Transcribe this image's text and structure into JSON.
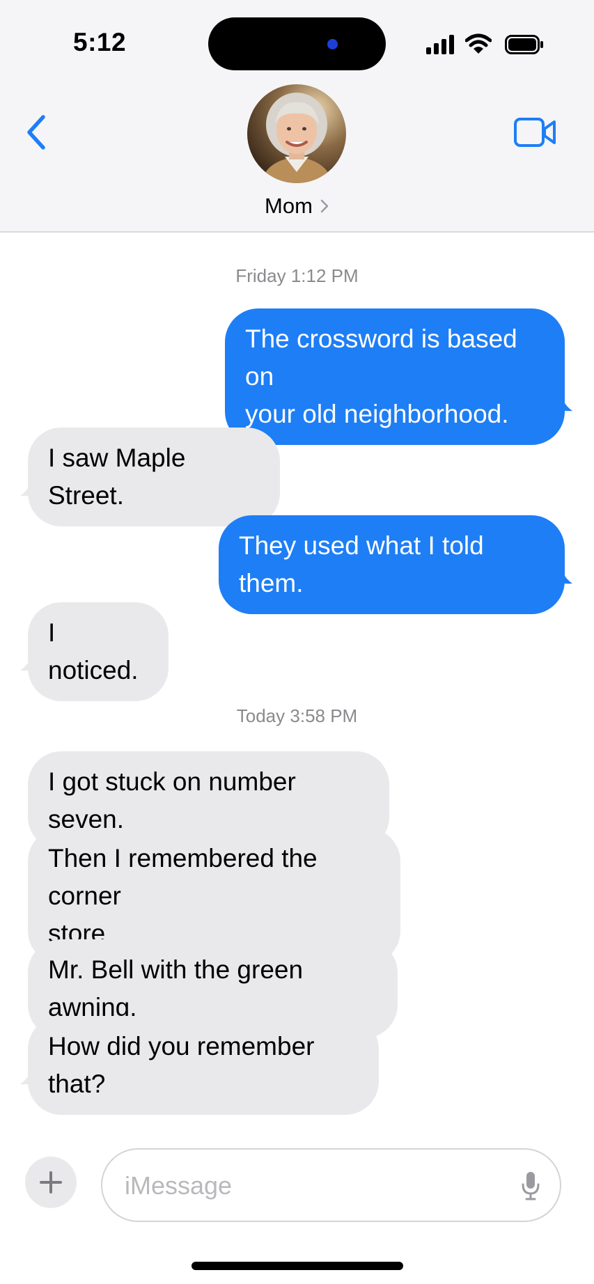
{
  "status_bar": {
    "time": "5:12"
  },
  "header": {
    "contact_name": "Mom"
  },
  "conversation": {
    "timestamps": [
      {
        "label": "Friday",
        "time": "1:12 PM"
      },
      {
        "label": "Today",
        "time": "3:58 PM"
      }
    ],
    "messages": [
      {
        "sender": "me",
        "lines": [
          "The crossword is based on",
          "your old neighborhood."
        ]
      },
      {
        "sender": "mom",
        "lines": [
          "I saw Maple Street."
        ]
      },
      {
        "sender": "me",
        "lines": [
          "They used what I told them."
        ]
      },
      {
        "sender": "mom",
        "lines": [
          "I noticed."
        ]
      },
      {
        "sender": "mom",
        "lines": [
          "I got stuck on number seven."
        ]
      },
      {
        "sender": "mom",
        "lines": [
          "Then I remembered the corner",
          "store."
        ]
      },
      {
        "sender": "mom",
        "lines": [
          "Mr. Bell with the green awning."
        ]
      },
      {
        "sender": "mom",
        "lines": [
          "How did you remember that?"
        ]
      }
    ]
  },
  "input_bar": {
    "placeholder": "iMessage",
    "value": ""
  },
  "icons": {
    "back": "chevron-left-icon",
    "video": "video-camera-icon",
    "plus": "plus-icon",
    "mic": "microphone-icon",
    "signal": "cellular-signal-icon",
    "wifi": "wifi-icon",
    "battery": "battery-icon"
  },
  "colors": {
    "accent": "#1e7ef5",
    "sent_bubble": "#1e7ef5",
    "received_bubble": "#e9e9eb",
    "timestamp_text": "#8a8a8e"
  }
}
